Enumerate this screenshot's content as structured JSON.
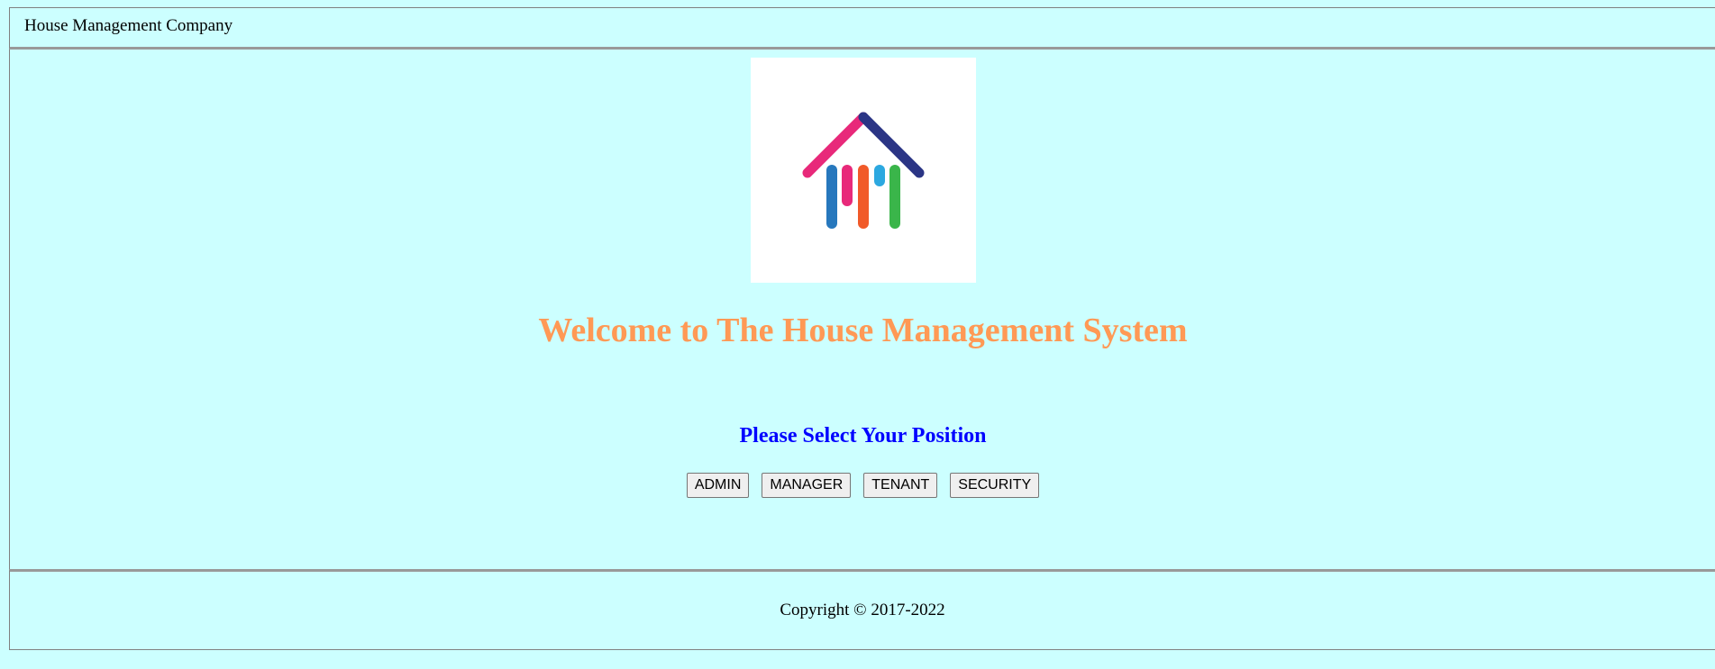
{
  "header": {
    "title": "House Management Company"
  },
  "main": {
    "logo_icon": "house-logo-icon",
    "welcome": "Welcome to The House Management System",
    "select_prompt": "Please Select Your Position",
    "positions": [
      "ADMIN",
      "MANAGER",
      "TENANT",
      "SECURITY"
    ]
  },
  "footer": {
    "copyright": "Copyright © 2017-2022"
  },
  "colors": {
    "background": "#ccffff",
    "welcome": "#ff9955",
    "prompt": "#0000ff"
  }
}
